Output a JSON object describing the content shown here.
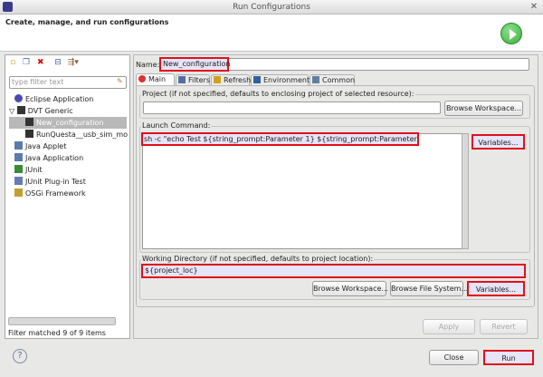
{
  "window": {
    "title": "Run Configurations"
  },
  "header": {
    "subtitle": "Create, manage, and run configurations",
    "run_icon": "green-run-icon"
  },
  "left": {
    "filter_placeholder": "type filter text",
    "tree": [
      {
        "label": "Eclipse Application",
        "icon": "eclipse-icon"
      },
      {
        "label": "DVT Generic",
        "icon": "terminal-icon",
        "expanded": true
      },
      {
        "label": "New_configuration",
        "icon": "terminal-icon",
        "selected": true
      },
      {
        "label": "RunQuesta__usb_sim_mo",
        "icon": "terminal-icon"
      },
      {
        "label": "Java Applet",
        "icon": "java-applet-icon"
      },
      {
        "label": "Java Application",
        "icon": "java-app-icon"
      },
      {
        "label": "JUnit",
        "icon": "junit-icon"
      },
      {
        "label": "JUnit Plug-in Test",
        "icon": "junit-plugin-icon"
      },
      {
        "label": "OSGi Framework",
        "icon": "osgi-icon"
      }
    ],
    "status": "Filter matched 9 of 9 items"
  },
  "main": {
    "name_label": "Name:",
    "name_value": "New_configuration",
    "tabs": [
      {
        "label": "Main",
        "active": true
      },
      {
        "label": "Filters"
      },
      {
        "label": "Refresh"
      },
      {
        "label": "Environment"
      },
      {
        "label": "Common"
      }
    ],
    "project_label": "Project (if not specified, defaults to enclosing project of selected resource):",
    "project_value": "",
    "browse_workspace": "Browse Workspace...",
    "launch_label": "Launch Command:",
    "launch_value": "sh -c \"echo Test ${string_prompt:Parameter 1} ${string_prompt:Parameter 2}\"",
    "variables": "Variables...",
    "workdir_label": "Working Directory (if not specified, defaults to project location):",
    "workdir_value": "${project_loc}",
    "browse_workspace2": "Browse Workspace...",
    "browse_fs": "Browse File System...",
    "variables2": "Variables...",
    "apply": "Apply",
    "revert": "Revert"
  },
  "footer": {
    "close": "Close",
    "run": "Run"
  },
  "colors": {
    "highlight": "#e0101a",
    "selection_fill": "#e6e4f7",
    "run_green": "#3cae3c"
  }
}
